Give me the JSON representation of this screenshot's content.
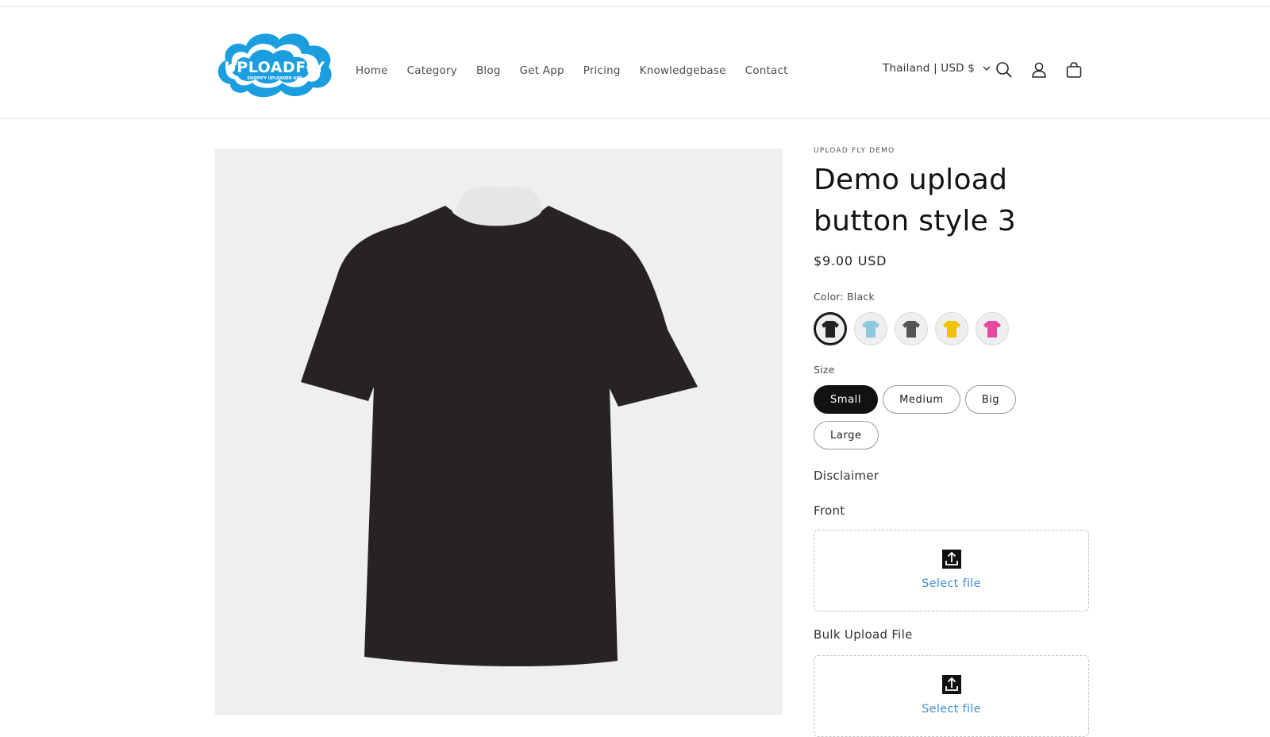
{
  "brand": {
    "name": "UPLOADFLY",
    "tagline": "SHOPIFY UPLOADER APP",
    "logo_color": "#1a9ee0"
  },
  "nav": {
    "items": [
      {
        "label": "Home"
      },
      {
        "label": "Category"
      },
      {
        "label": "Blog"
      },
      {
        "label": "Get App"
      },
      {
        "label": "Pricing"
      },
      {
        "label": "Knowledgebase"
      },
      {
        "label": "Contact"
      }
    ]
  },
  "header": {
    "locale_label": "Thailand | USD $",
    "icons": [
      "search-icon",
      "account-icon",
      "cart-icon"
    ]
  },
  "product": {
    "vendor": "UPLOAD FLY DEMO",
    "title": "Demo upload button style 3",
    "price": "$9.00 USD",
    "color_label": "Color: Black",
    "colors": [
      {
        "name": "Black",
        "hex": "#222222",
        "selected": true
      },
      {
        "name": "Light Blue",
        "hex": "#8fc8dd",
        "selected": false
      },
      {
        "name": "Gray",
        "hex": "#555555",
        "selected": false
      },
      {
        "name": "Yellow",
        "hex": "#f2c200",
        "selected": false
      },
      {
        "name": "Pink",
        "hex": "#e34aa0",
        "selected": false
      }
    ],
    "size_label": "Size",
    "sizes": [
      {
        "label": "Small",
        "selected": true
      },
      {
        "label": "Medium",
        "selected": false
      },
      {
        "label": "Big",
        "selected": false
      },
      {
        "label": "Large",
        "selected": false
      }
    ],
    "disclaimer": "Disclaimer",
    "uploads": [
      {
        "label": "Front",
        "link_text": "Select file"
      },
      {
        "label": "Bulk Upload File",
        "link_text": "Select file"
      }
    ]
  },
  "colors": {
    "link": "#3f8fd6",
    "text": "#121212",
    "media_bg": "#efefef"
  }
}
